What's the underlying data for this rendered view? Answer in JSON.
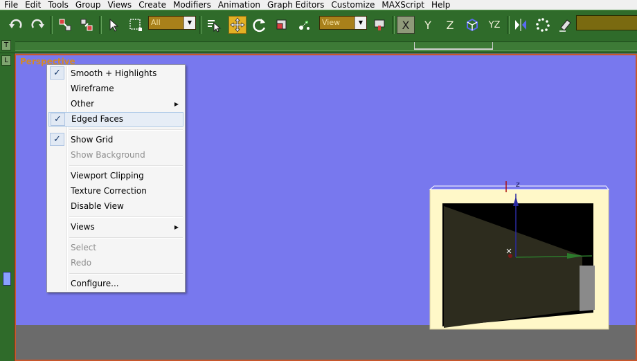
{
  "menubar": [
    "File",
    "Edit",
    "Tools",
    "Group",
    "Views",
    "Create",
    "Modifiers",
    "Animation",
    "Graph Editors",
    "Customize",
    "MAXScript",
    "Help"
  ],
  "toolbar": {
    "selection_filter": "All",
    "reference_coord": "View",
    "axis_x": "X",
    "axis_y": "Y",
    "axis_z": "Z",
    "axis_yz": "YZ"
  },
  "strip": {
    "track_button": "T"
  },
  "leftbar": {
    "layout_button": "L"
  },
  "viewport": {
    "label": "Perspective",
    "gizmo_z": "z"
  },
  "context_menu": {
    "items": [
      {
        "label": "Smooth + Highlights",
        "checked": true
      },
      {
        "label": "Wireframe"
      },
      {
        "label": "Other",
        "submenu": true
      },
      {
        "label": "Edged Faces",
        "checked": true,
        "highlight": true
      },
      {
        "label": "Show Grid",
        "checked": true
      },
      {
        "label": "Show Background",
        "disabled": true
      },
      {
        "label": "Viewport Clipping"
      },
      {
        "label": "Texture Correction"
      },
      {
        "label": "Disable View"
      },
      {
        "label": "Views",
        "submenu": true
      },
      {
        "label": "Select",
        "disabled": true
      },
      {
        "label": "Redo",
        "disabled": true
      },
      {
        "label": "Configure..."
      }
    ]
  },
  "colors": {
    "toolbar_bg": "#2f6b2a",
    "viewport_bg": "#7878ee",
    "viewport_border": "#c8572c",
    "active_tool": "#e3b024",
    "frame_cream": "#fff8c8"
  },
  "icons": [
    "undo-icon",
    "redo-icon",
    "link-icon",
    "unlink-icon",
    "select-arrow-icon",
    "region-select-icon",
    "select-by-name-icon",
    "move-icon",
    "rotate-icon",
    "scale-icon",
    "pivot-icon",
    "snap-icon",
    "mirror-icon",
    "array-icon",
    "eraser-icon",
    "checkmark-icon",
    "submenu-arrow-icon"
  ]
}
